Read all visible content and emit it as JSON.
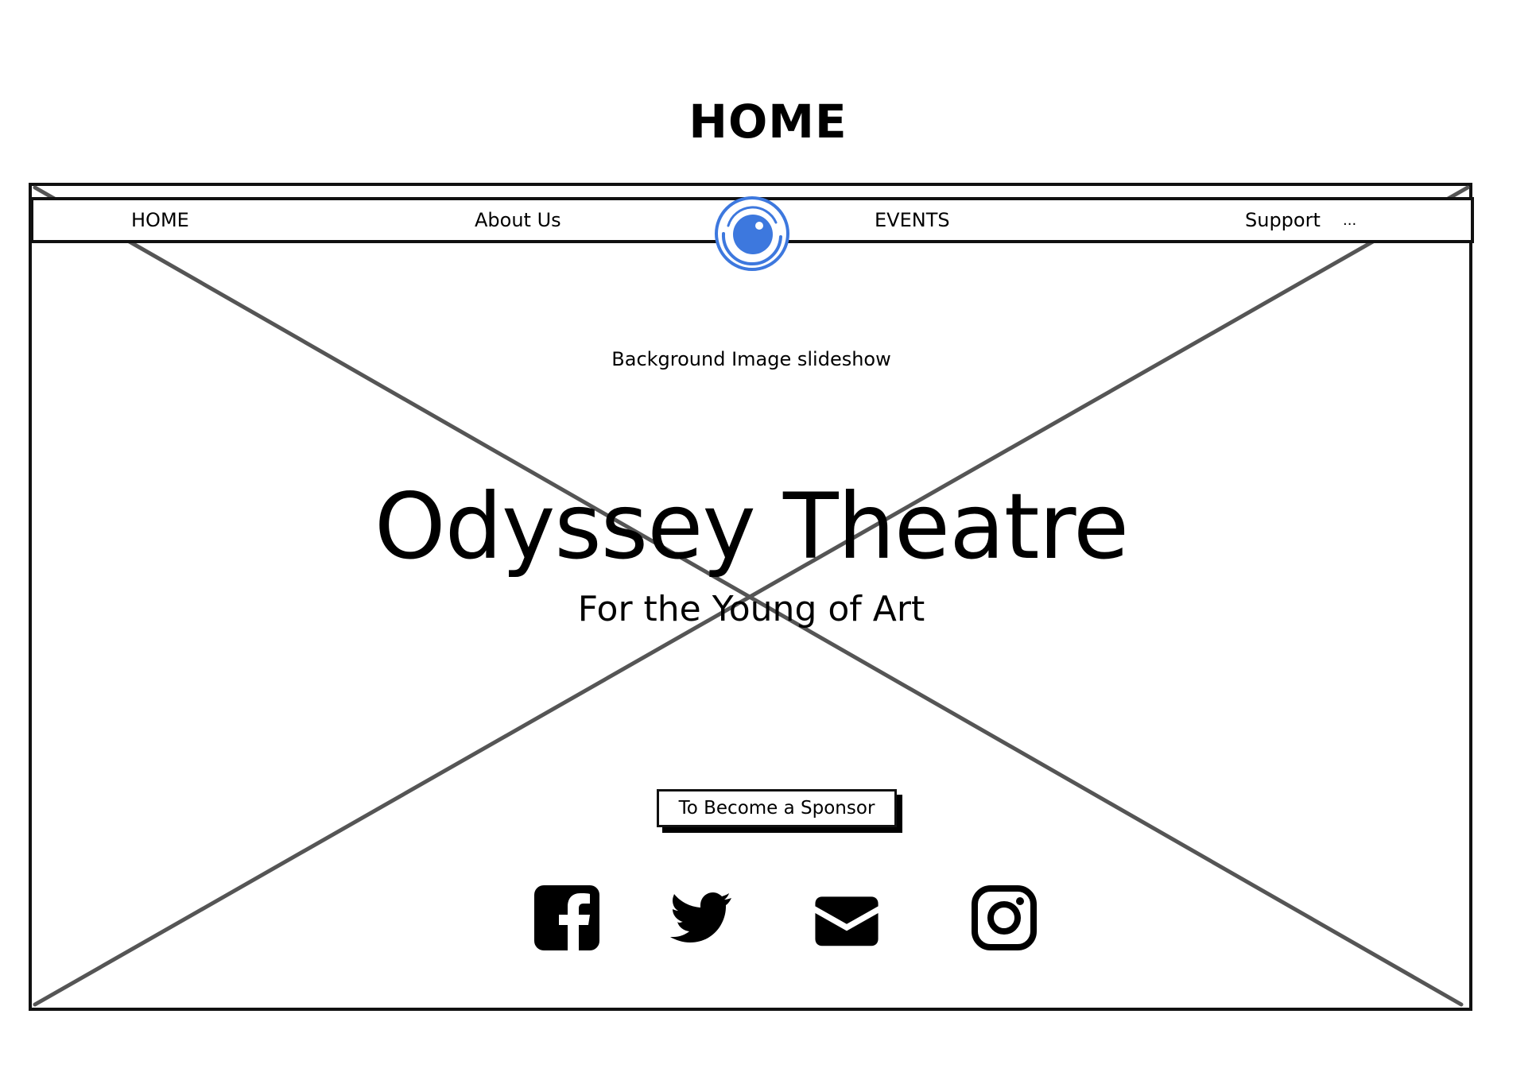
{
  "page": {
    "heading": "HOME"
  },
  "nav": {
    "items": [
      {
        "label": "HOME"
      },
      {
        "label": "About Us"
      },
      {
        "label": "EVENTS"
      },
      {
        "label": "Support"
      }
    ],
    "more_label": "..."
  },
  "hero": {
    "caption": "Background Image slideshow",
    "title": "Odyssey Theatre",
    "subtitle": "For the Young of Art",
    "cta_label": "To Become a Sponsor"
  },
  "social": {
    "icons": [
      "facebook-icon",
      "twitter-icon",
      "mail-icon",
      "instagram-icon"
    ]
  },
  "colors": {
    "logo_accent": "#3d78de",
    "line": "#555555",
    "ink": "#111111"
  }
}
